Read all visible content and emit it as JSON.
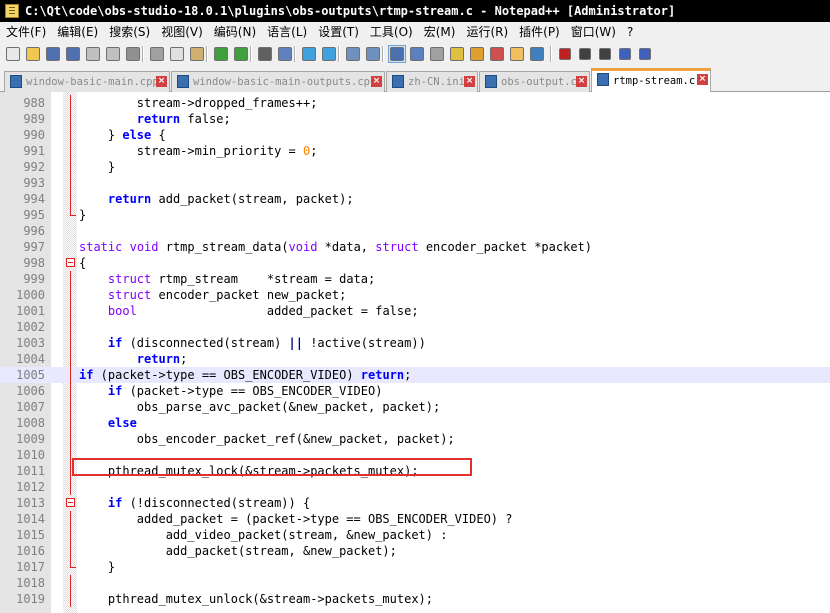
{
  "window": {
    "title": "C:\\Qt\\code\\obs-studio-18.0.1\\plugins\\obs-outputs\\rtmp-stream.c - Notepad++ [Administrator]"
  },
  "menu": [
    "文件(F)",
    "编辑(E)",
    "搜索(S)",
    "视图(V)",
    "编码(N)",
    "语言(L)",
    "设置(T)",
    "工具(O)",
    "宏(M)",
    "运行(R)",
    "插件(P)",
    "窗口(W)",
    "?"
  ],
  "toolbar": {
    "icons": [
      "new-file-icon",
      "open-file-icon",
      "save-icon",
      "save-all-icon",
      "close-icon",
      "close-all-icon",
      "print-icon",
      "cut-icon",
      "copy-icon",
      "paste-icon",
      "undo-icon",
      "redo-icon",
      "find-icon",
      "replace-icon",
      "zoom-in-icon",
      "zoom-out-icon",
      "sync-vertical-icon",
      "sync-horizontal-icon",
      "word-wrap-icon",
      "show-all-chars-icon",
      "indent-guide-icon",
      "user-lang-icon",
      "doc-map-icon",
      "function-list-icon",
      "folder-workspace-icon",
      "monitor-icon",
      "record-macro-icon",
      "stop-macro-icon",
      "play-macro-icon",
      "run-macro-multiple-icon",
      "save-macro-icon"
    ]
  },
  "tabs": [
    {
      "label": "window-basic-main.cpp",
      "active": false
    },
    {
      "label": "window-basic-main-outputs.cpp",
      "active": false
    },
    {
      "label": "zh-CN.ini",
      "active": false
    },
    {
      "label": "obs-output.c",
      "active": false
    },
    {
      "label": "rtmp-stream.c",
      "active": true
    }
  ],
  "editor": {
    "current_line": 1005,
    "lines": [
      {
        "n": "988",
        "html": "        stream->dropped_frames++;"
      },
      {
        "n": "989",
        "html": "        <span class=\"kw\">return</span> false;"
      },
      {
        "n": "990",
        "html": "    } <span class=\"kw\">else</span> {"
      },
      {
        "n": "991",
        "html": "        stream->min_priority = <span class=\"nm\">0</span>;"
      },
      {
        "n": "992",
        "html": "    }"
      },
      {
        "n": "993",
        "html": ""
      },
      {
        "n": "994",
        "html": "    <span class=\"kw\">return</span> add_packet(stream, packet);"
      },
      {
        "n": "995",
        "html": "}"
      },
      {
        "n": "996",
        "html": ""
      },
      {
        "n": "997",
        "html": "<span class=\"ty\">static</span> <span class=\"ty\">void</span> rtmp_stream_data(<span class=\"ty\">void</span> *data, <span class=\"ty\">struct</span> encoder_packet *packet)"
      },
      {
        "n": "998",
        "html": "{"
      },
      {
        "n": "999",
        "html": "    <span class=\"ty\">struct</span> rtmp_stream    *stream = data;"
      },
      {
        "n": "1000",
        "html": "    <span class=\"ty\">struct</span> encoder_packet new_packet;"
      },
      {
        "n": "1001",
        "html": "    <span class=\"ty\">bool</span>                  added_packet = false;"
      },
      {
        "n": "1002",
        "html": ""
      },
      {
        "n": "1003",
        "html": "    <span class=\"kw\">if</span> (disconnected(stream) <span class=\"op\">||</span> !active(stream))"
      },
      {
        "n": "1004",
        "html": "        <span class=\"kw\">return</span>;"
      },
      {
        "n": "1005",
        "html": "<span class=\"kw\">if</span> (packet->type == OBS_ENCODER_VIDEO) <span class=\"kw\">return</span>;"
      },
      {
        "n": "1006",
        "html": "    <span class=\"kw\">if</span> (packet->type == OBS_ENCODER_VIDEO)"
      },
      {
        "n": "1007",
        "html": "        obs_parse_avc_packet(&new_packet, packet);"
      },
      {
        "n": "1008",
        "html": "    <span class=\"kw\">else</span>"
      },
      {
        "n": "1009",
        "html": "        obs_encoder_packet_ref(&new_packet, packet);"
      },
      {
        "n": "1010",
        "html": ""
      },
      {
        "n": "1011",
        "html": "    pthread_mutex_lock(&stream->packets_mutex);"
      },
      {
        "n": "1012",
        "html": ""
      },
      {
        "n": "1013",
        "html": "    <span class=\"kw\">if</span> (!disconnected(stream)) {"
      },
      {
        "n": "1014",
        "html": "        added_packet = (packet->type == OBS_ENCODER_VIDEO) ?"
      },
      {
        "n": "1015",
        "html": "            add_video_packet(stream, &new_packet) :"
      },
      {
        "n": "1016",
        "html": "            add_packet(stream, &new_packet);"
      },
      {
        "n": "1017",
        "html": "    }"
      },
      {
        "n": "1018",
        "html": ""
      },
      {
        "n": "1019",
        "html": "    pthread_mutex_unlock(&stream->packets_mutex);"
      }
    ]
  }
}
